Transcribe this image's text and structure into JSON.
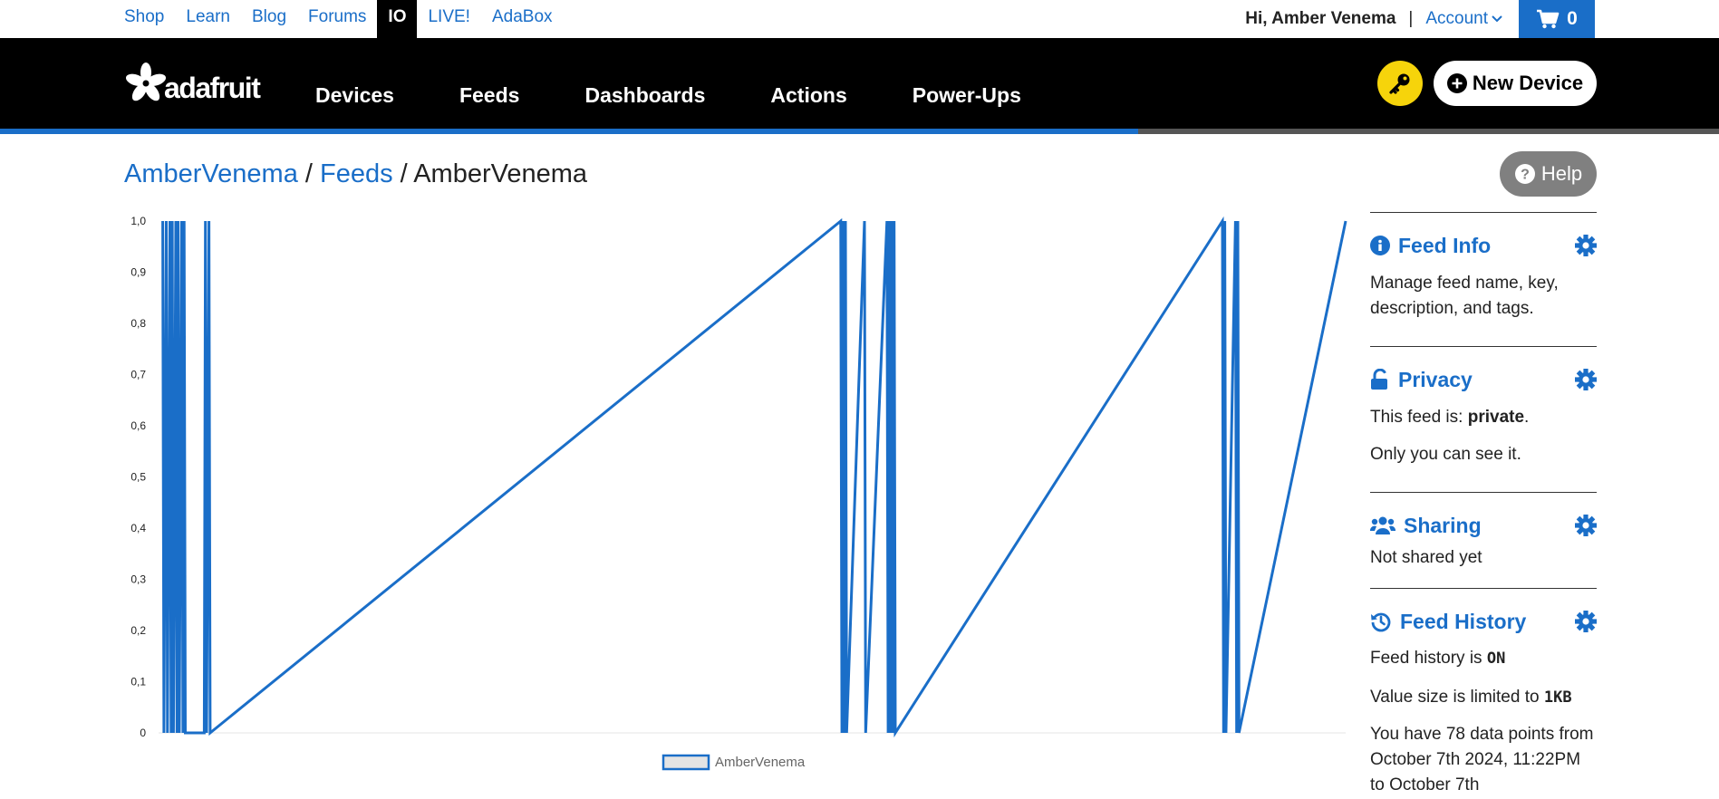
{
  "topnav": {
    "links": [
      "Shop",
      "Learn",
      "Blog",
      "Forums",
      "IO",
      "LIVE!",
      "AdaBox"
    ],
    "greeting": "Hi, Amber Venema",
    "separator": "|",
    "account": "Account",
    "cart_count": "0"
  },
  "header": {
    "logo_text": "adafruit",
    "nav": [
      "Devices",
      "Feeds",
      "Dashboards",
      "Actions",
      "Power-Ups"
    ],
    "new_device": "New Device",
    "brand_colors": {
      "blue": "#1a6ec8",
      "yellow": "#f6d40b",
      "black": "#000000"
    },
    "progress_fraction": 0.662
  },
  "breadcrumb": {
    "user": "AmberVenema",
    "sep1": " / ",
    "feeds": "Feeds",
    "sep2": " / ",
    "current": "AmberVenema"
  },
  "help": "Help",
  "chart_data": {
    "type": "line",
    "y_ticks": [
      "0",
      "0,1",
      "0,2",
      "0,3",
      "0,4",
      "0,5",
      "0,6",
      "0,7",
      "0,8",
      "0,9",
      "1,0"
    ],
    "ylim": [
      0,
      1
    ],
    "xlim": [
      0,
      100
    ],
    "series": [
      {
        "name": "AmberVenema",
        "color": "#1a6ec8",
        "points": [
          [
            0.2,
            1
          ],
          [
            0.3,
            0
          ],
          [
            0.5,
            1
          ],
          [
            0.6,
            0
          ],
          [
            0.8,
            1
          ],
          [
            0.9,
            0
          ],
          [
            1.0,
            1
          ],
          [
            1.1,
            0
          ],
          [
            1.3,
            1
          ],
          [
            1.4,
            0
          ],
          [
            1.5,
            1
          ],
          [
            1.6,
            0
          ],
          [
            1.8,
            1
          ],
          [
            1.9,
            0
          ],
          [
            2.0,
            1
          ],
          [
            2.1,
            0
          ],
          [
            3.7,
            0
          ],
          [
            3.8,
            1
          ],
          [
            3.9,
            0
          ],
          [
            4.1,
            1
          ],
          [
            4.2,
            0
          ],
          [
            57.4,
            1
          ],
          [
            57.5,
            0
          ],
          [
            57.6,
            1
          ],
          [
            57.7,
            0
          ],
          [
            57.8,
            1
          ],
          [
            57.9,
            0
          ],
          [
            59.4,
            1
          ],
          [
            59.5,
            0
          ],
          [
            61.3,
            1
          ],
          [
            61.4,
            0
          ],
          [
            61.5,
            1
          ],
          [
            61.6,
            0
          ],
          [
            61.7,
            1
          ],
          [
            61.8,
            0
          ],
          [
            61.9,
            1
          ],
          [
            62.0,
            0
          ],
          [
            89.6,
            1
          ],
          [
            89.7,
            0
          ],
          [
            89.8,
            1
          ],
          [
            89.9,
            0
          ],
          [
            90.7,
            1
          ],
          [
            90.8,
            0
          ],
          [
            90.9,
            1
          ],
          [
            91.0,
            0
          ],
          [
            100,
            1
          ]
        ]
      }
    ]
  },
  "side": {
    "feed_info": {
      "title": "Feed Info",
      "desc": "Manage feed name, key, description, and tags."
    },
    "privacy": {
      "title": "Privacy",
      "line1_pre": "This feed is: ",
      "status": "private",
      "line1_post": ".",
      "line2": "Only you can see it."
    },
    "sharing": {
      "title": "Sharing",
      "desc": "Not shared yet"
    },
    "history": {
      "title": "Feed History",
      "line1_pre": "Feed history is ",
      "status": "ON",
      "line2_pre": "Value size is limited to ",
      "limit": "1KB",
      "line3": "You have 78 data points from October 7th 2024, 11:22PM to October 7th"
    }
  }
}
